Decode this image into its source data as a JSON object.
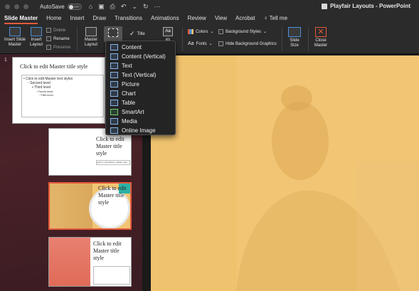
{
  "titlebar": {
    "autosave_label": "AutoSave",
    "autosave_state": "OFF",
    "doc_title": "Playfair Layouts - PowerPoint"
  },
  "tabs": [
    {
      "label": "Slide Master",
      "active": true
    },
    {
      "label": "Home"
    },
    {
      "label": "Insert"
    },
    {
      "label": "Draw"
    },
    {
      "label": "Transitions"
    },
    {
      "label": "Animations"
    },
    {
      "label": "Review"
    },
    {
      "label": "View"
    },
    {
      "label": "Acrobat"
    },
    {
      "label": "Tell me"
    }
  ],
  "ribbon": {
    "insert_slide_master": "Insert Slide Master",
    "insert_layout": "Insert Layout",
    "delete": "Delete",
    "rename": "Rename",
    "preserve": "Preserve",
    "master_layout": "Master Layout",
    "insert_placeholder_short": "P",
    "title_check": "Title",
    "themes_short": "es",
    "colors": "Colors",
    "fonts": "Fonts",
    "background_styles": "Background Styles",
    "hide_background_graphics": "Hide Background Graphics",
    "slide_size": "Slide Size",
    "close_master": "Close Master"
  },
  "dropdown": {
    "items": [
      "Content",
      "Content (Vertical)",
      "Text",
      "Text (Vertical)",
      "Picture",
      "Chart",
      "Table",
      "SmartArt",
      "Media",
      "Online Image"
    ]
  },
  "thumbnails": {
    "slide_number": "1",
    "master_title": "Click to edit Master title style",
    "master_body": "• Click to edit Master text styles",
    "level2": "◦ Second level",
    "level3": "▪ Third level",
    "level4": "◦ Fourth level",
    "level5": "◦ Fifth level",
    "layout_title": "Click to edit Master title style",
    "layout_subtitle": "Click to edit Master subtitle style"
  },
  "colors": {
    "accent": "#e45a3b",
    "slide_bg": "#f1c574",
    "teal": "#2bb3a6"
  }
}
